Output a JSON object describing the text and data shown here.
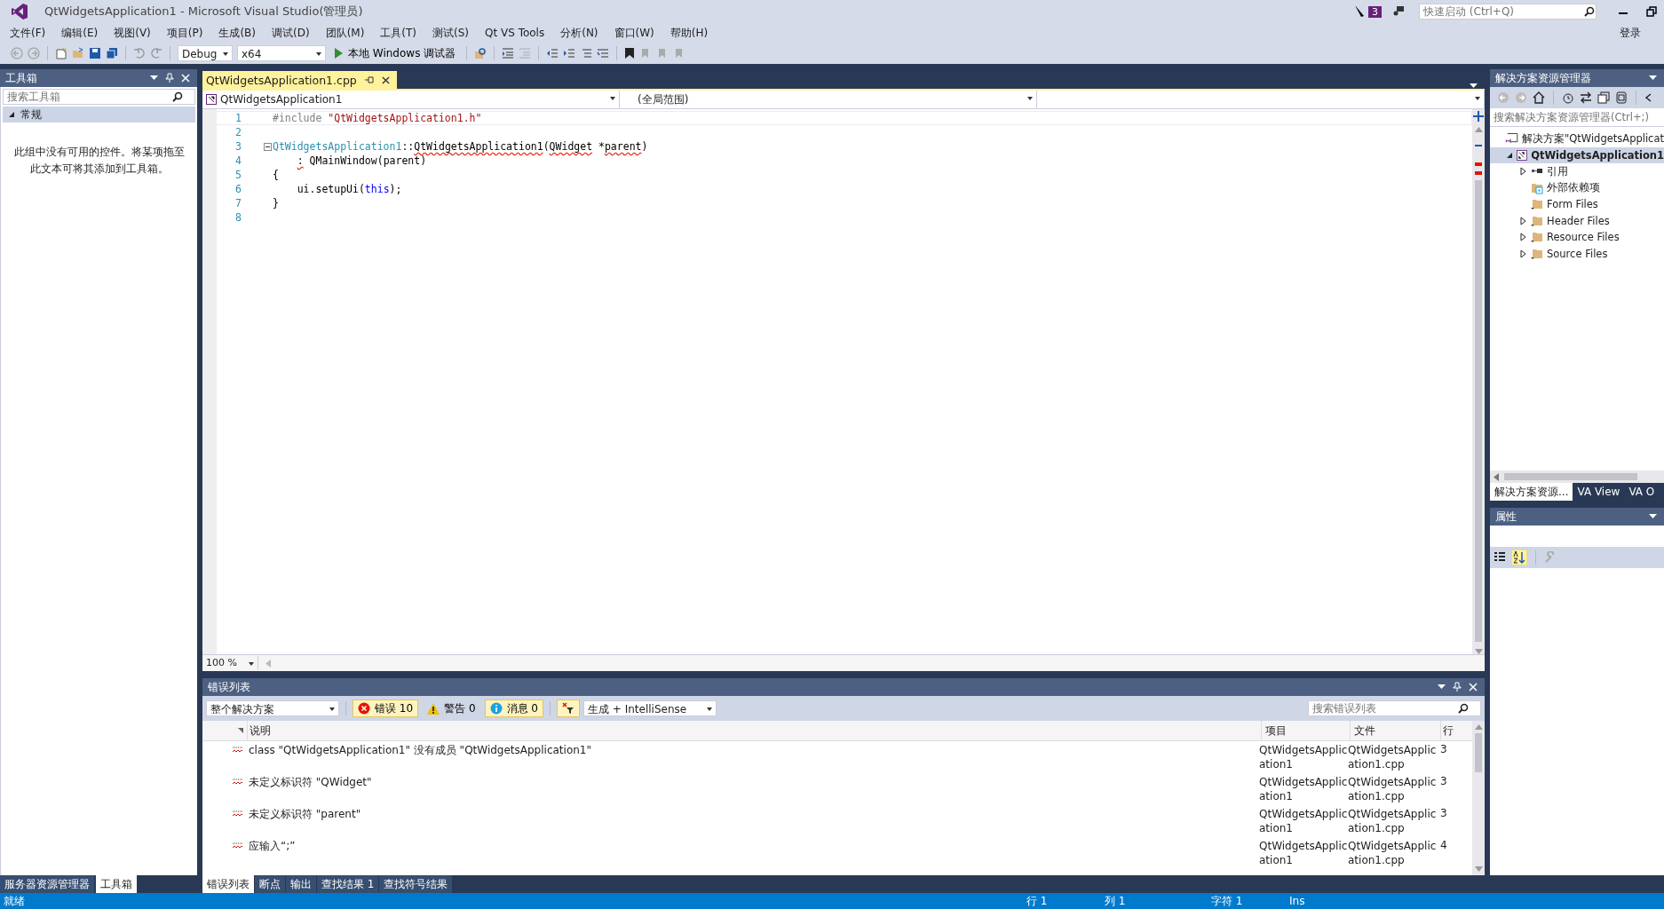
{
  "window": {
    "title": "QtWidgetsApplication1 - Microsoft Visual Studio(管理员)",
    "notification_count": "3",
    "quick_launch": {
      "placeholder": "快速启动 (Ctrl+Q)"
    },
    "sign_in": "登录"
  },
  "menu": [
    "文件(F)",
    "编辑(E)",
    "视图(V)",
    "项目(P)",
    "生成(B)",
    "调试(D)",
    "团队(M)",
    "工具(T)",
    "测试(S)",
    "Qt VS Tools",
    "分析(N)",
    "窗口(W)",
    "帮助(H)"
  ],
  "toolbar": {
    "configuration": "Debug",
    "platform": "x64",
    "run": "本地 Windows 调试器"
  },
  "toolbox": {
    "title": "工具箱",
    "search": {
      "placeholder": "搜索工具箱"
    },
    "group": {
      "label": "常规",
      "expanded": true
    },
    "empty_text": "此组中没有可用的控件。将某项拖至此文本可将其添加到工具箱。",
    "tabs": [
      {
        "label": "服务器资源管理器",
        "selected": false
      },
      {
        "label": "工具箱",
        "selected": true
      }
    ]
  },
  "editor": {
    "tabs": [
      {
        "label": "QtWidgetsApplication1.cpp",
        "selected": true
      }
    ],
    "nav": {
      "project": "QtWidgetsApplication1",
      "scope": "(全局范围)"
    },
    "zoom": "100 %",
    "lines": [
      {
        "number": "1",
        "tokens": [
          {
            "kind": "preproc",
            "text": "#include "
          },
          {
            "kind": "string",
            "text": "\"QtWidgetsApplication1.h\""
          }
        ]
      },
      {
        "number": "2"
      },
      {
        "number": "3",
        "fold": true,
        "tokens": [
          {
            "kind": "type",
            "text": "QtWidgetsApplication1"
          },
          {
            "kind": "plain",
            "text": "::"
          },
          {
            "kind": "plain",
            "text": "QtWidgetsApplication1",
            "squiggle": true
          },
          {
            "kind": "plain",
            "text": "("
          },
          {
            "kind": "plain",
            "text": "QWidget",
            "squiggle": true
          },
          {
            "kind": "plain",
            "text": " *"
          },
          {
            "kind": "plain",
            "text": "parent",
            "squiggle": true
          },
          {
            "kind": "plain",
            "text": ")"
          }
        ]
      },
      {
        "number": "4",
        "kind": "indented",
        "tokens": [
          {
            "kind": "plain",
            "text": ":",
            "squiggle": true
          },
          {
            "kind": "plain",
            "text": " QMainWindow(parent)"
          }
        ]
      },
      {
        "number": "5",
        "tokens": [
          {
            "kind": "plain",
            "text": "{"
          }
        ]
      },
      {
        "number": "6",
        "kind": "indented",
        "tokens": [
          {
            "kind": "plain",
            "text": "ui.setupUi("
          },
          {
            "kind": "keyword",
            "text": "this"
          },
          {
            "kind": "plain",
            "text": ");"
          }
        ]
      },
      {
        "number": "7",
        "tokens": [
          {
            "kind": "plain",
            "text": "}"
          }
        ]
      },
      {
        "number": "8"
      }
    ]
  },
  "error_list": {
    "title": "错误列表",
    "scope": "整个解决方案",
    "filters": [
      {
        "kind": "error",
        "label": "错误 10",
        "on": true
      },
      {
        "kind": "warning",
        "label": "警告 0",
        "on": false
      },
      {
        "kind": "info",
        "label": "消息 0",
        "on": true
      }
    ],
    "source": "生成 + IntelliSense",
    "search": {
      "placeholder": "搜索错误列表"
    },
    "columns": [
      "说明",
      "项目",
      "文件",
      "行"
    ],
    "rows": [
      {
        "description": "class \"QtWidgetsApplication1\" 没有成员 \"QtWidgetsApplication1\"",
        "project": "QtWidgetsApplication1",
        "file": "QtWidgetsApplication1.cpp",
        "line": "3"
      },
      {
        "description": "未定义标识符 \"QWidget\"",
        "project": "QtWidgetsApplication1",
        "file": "QtWidgetsApplication1.cpp",
        "line": "3"
      },
      {
        "description": "未定义标识符 \"parent\"",
        "project": "QtWidgetsApplication1",
        "file": "QtWidgetsApplication1.cpp",
        "line": "3"
      },
      {
        "description": "应输入“;”",
        "project": "QtWidgetsApplication1",
        "file": "QtWidgetsApplication1.cpp",
        "line": "4"
      }
    ],
    "tabs": [
      {
        "label": "错误列表",
        "selected": true
      },
      {
        "label": "断点",
        "selected": false
      },
      {
        "label": "输出",
        "selected": false
      },
      {
        "label": "查找结果 1",
        "selected": false
      },
      {
        "label": "查找符号结果",
        "selected": false
      }
    ]
  },
  "solution_explorer": {
    "title": "解决方案资源管理器",
    "search": {
      "placeholder": "搜索解决方案资源管理器(Ctrl+;)"
    },
    "tree": [
      {
        "label": "解决方案\"QtWidgetsApplicat",
        "kind": "solution",
        "bold": false,
        "selected": false,
        "children": [
          {
            "label": "QtWidgetsApplication1",
            "kind": "project",
            "bold": true,
            "selected": true,
            "expanded": true,
            "children": [
              {
                "label": "引用",
                "kind": "references",
                "bold": false,
                "selected": false,
                "expanded": false
              },
              {
                "label": "外部依赖项",
                "kind": "external",
                "bold": false,
                "selected": false
              },
              {
                "label": "Form Files",
                "kind": "folder",
                "bold": false,
                "selected": false
              },
              {
                "label": "Header Files",
                "kind": "folder",
                "bold": false,
                "selected": false,
                "expanded": false
              },
              {
                "label": "Resource Files",
                "kind": "folder",
                "bold": false,
                "selected": false,
                "expanded": false
              },
              {
                "label": "Source Files",
                "kind": "folder",
                "bold": false,
                "selected": false,
                "expanded": false
              }
            ]
          }
        ]
      }
    ],
    "tabs": [
      {
        "label": "解决方案资源...",
        "selected": true
      },
      {
        "label": "VA View",
        "selected": false
      },
      {
        "label": "VA O",
        "selected": false
      }
    ]
  },
  "properties": {
    "title": "属性"
  },
  "status_bar": {
    "state": "就绪",
    "items": [
      "行 1",
      "列 1",
      "字符 1",
      "Ins"
    ]
  }
}
